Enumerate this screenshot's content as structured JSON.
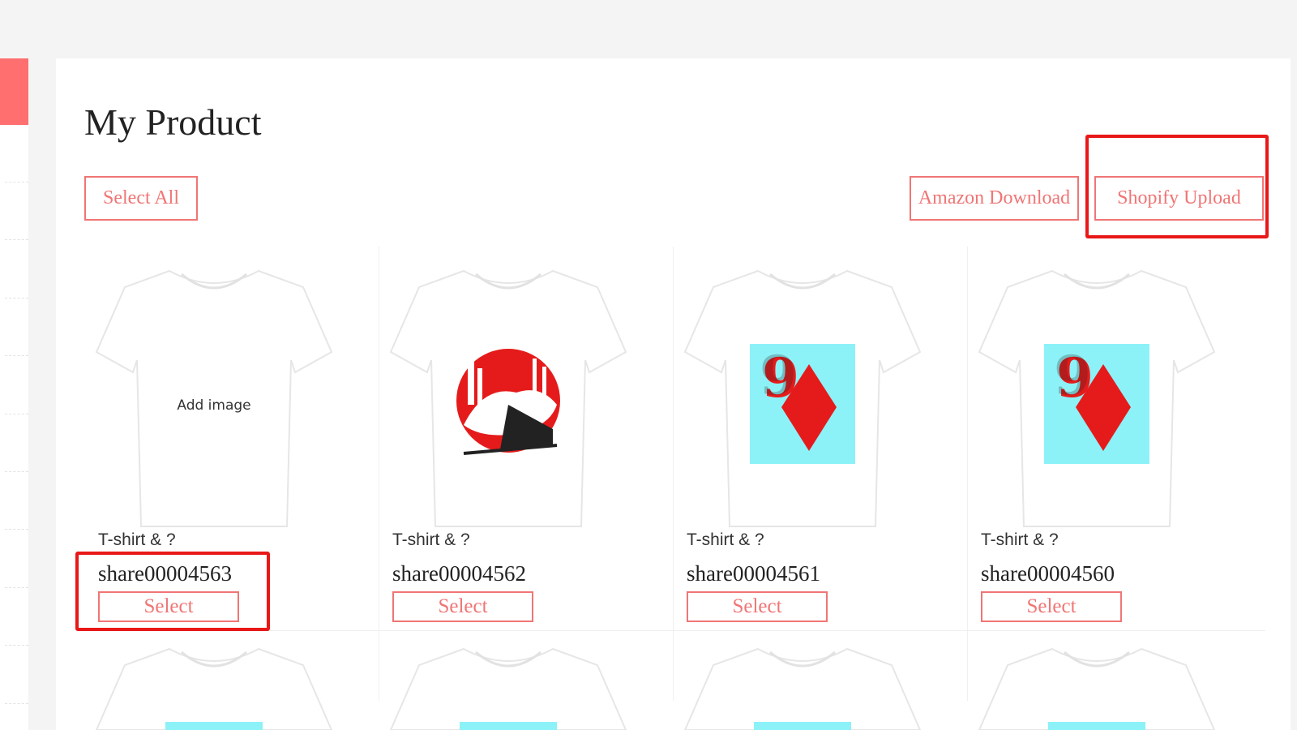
{
  "page": {
    "title": "My Product"
  },
  "toolbar": {
    "select_all": "Select All",
    "amazon_download": "Amazon Download",
    "shopify_upload": "Shopify Upload"
  },
  "colors": {
    "accent": "#f07575",
    "highlight": "#e81818",
    "design_cyan": "#8cf2f8",
    "design_red": "#e51b1b"
  },
  "products": [
    {
      "type": "T-shirt & ?",
      "name": "share00004563",
      "select_label": "Select",
      "design": "add-image",
      "placeholder": "Add image"
    },
    {
      "type": "T-shirt & ?",
      "name": "share00004562",
      "select_label": "Select",
      "design": "train-illustration"
    },
    {
      "type": "T-shirt & ?",
      "name": "share00004561",
      "select_label": "Select",
      "design": "nine-of-diamonds"
    },
    {
      "type": "T-shirt & ?",
      "name": "share00004560",
      "select_label": "Select",
      "design": "nine-of-diamonds"
    }
  ]
}
